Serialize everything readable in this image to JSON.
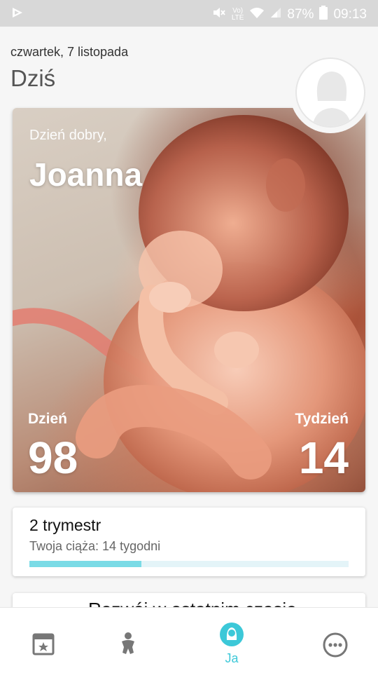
{
  "status_bar": {
    "battery": "87%",
    "time": "09:13",
    "network": "LTE"
  },
  "header": {
    "date": "czwartek, 7 listopada",
    "title": "Dziś"
  },
  "hero": {
    "greeting": "Dzień dobry,",
    "name": "Joanna",
    "day_label": "Dzień",
    "day_value": "98",
    "week_label": "Tydzień",
    "week_value": "14"
  },
  "trimester": {
    "title": "2 trymestr",
    "subtitle": "Twoja ciąża: 14 tygodni",
    "progress": 0.35
  },
  "next_card": {
    "title": "Rozwój w ostatnim czasie"
  },
  "bottom_nav": {
    "items": [
      {
        "icon": "calendar-star-icon",
        "label": ""
      },
      {
        "icon": "baby-icon",
        "label": ""
      },
      {
        "icon": "mother-icon",
        "label": "Ja",
        "active": true
      },
      {
        "icon": "more-icon",
        "label": ""
      }
    ]
  },
  "colors": {
    "accent": "#3cc8d8",
    "progress_fill": "#7adbe6",
    "progress_track": "#e4f4f8",
    "status_bar": "#d8d8d8"
  }
}
